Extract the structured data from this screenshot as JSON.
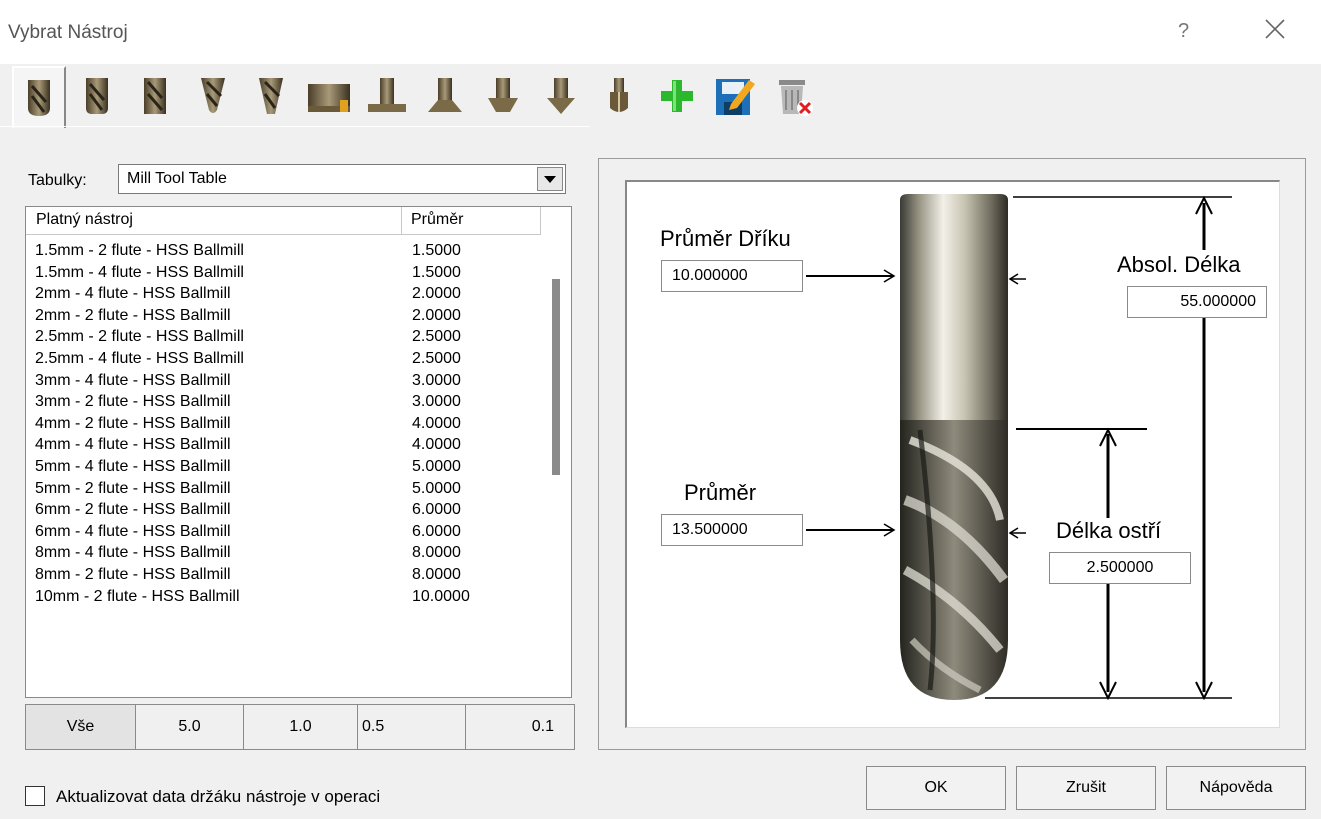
{
  "window": {
    "title": "Vybrat Nástroj",
    "help_glyph": "?",
    "close_icon": "close-icon"
  },
  "toolbar": {
    "tools": [
      {
        "name": "ballmill-tool-icon",
        "selected": true
      },
      {
        "name": "bullnose-tool-icon"
      },
      {
        "name": "flat-endmill-tool-icon"
      },
      {
        "name": "taper-ballmill-tool-icon"
      },
      {
        "name": "taper-endmill-tool-icon"
      },
      {
        "name": "face-mill-tool-icon"
      },
      {
        "name": "t-slot-tool-icon"
      },
      {
        "name": "dovetail-tool-icon"
      },
      {
        "name": "lollipop-tool-icon"
      },
      {
        "name": "drill-tool-icon"
      },
      {
        "name": "reamer-tool-icon"
      },
      {
        "name": "add-tool-icon"
      },
      {
        "name": "edit-tool-icon"
      },
      {
        "name": "delete-tool-icon"
      }
    ]
  },
  "table_selector": {
    "label": "Tabulky:",
    "value": "Mill Tool Table"
  },
  "tool_list": {
    "headers": {
      "name": "Platný nástroj",
      "diameter": "Průměr"
    },
    "rows": [
      {
        "name": "1.5mm - 2 flute - HSS Ballmill",
        "diameter": "1.5000"
      },
      {
        "name": "1.5mm - 4 flute - HSS Ballmill",
        "diameter": "1.5000"
      },
      {
        "name": "2mm - 4 flute - HSS Ballmill",
        "diameter": "2.0000"
      },
      {
        "name": "2mm - 2 flute - HSS Ballmill",
        "diameter": "2.0000"
      },
      {
        "name": "2.5mm - 2 flute - HSS Ballmill",
        "diameter": "2.5000"
      },
      {
        "name": "2.5mm - 4 flute - HSS Ballmill",
        "diameter": "2.5000"
      },
      {
        "name": "3mm - 4 flute - HSS Ballmill",
        "diameter": "3.0000"
      },
      {
        "name": "3mm - 2 flute - HSS Ballmill",
        "diameter": "3.0000"
      },
      {
        "name": "4mm - 2 flute - HSS Ballmill",
        "diameter": "4.0000"
      },
      {
        "name": "4mm - 4 flute - HSS Ballmill",
        "diameter": "4.0000"
      },
      {
        "name": "5mm - 4 flute - HSS Ballmill",
        "diameter": "5.0000"
      },
      {
        "name": "5mm - 2 flute - HSS Ballmill",
        "diameter": "5.0000"
      },
      {
        "name": "6mm - 2 flute - HSS Ballmill",
        "diameter": "6.0000"
      },
      {
        "name": "6mm - 4 flute - HSS Ballmill",
        "diameter": "6.0000"
      },
      {
        "name": "8mm - 4 flute - HSS Ballmill",
        "diameter": "8.0000"
      },
      {
        "name": "8mm - 2 flute - HSS Ballmill",
        "diameter": "8.0000"
      },
      {
        "name": "10mm - 2 flute - HSS Ballmill",
        "diameter": "10.0000"
      }
    ]
  },
  "filters": {
    "buttons": [
      "Vše",
      "5.0",
      "1.0",
      "0.5",
      "0.1"
    ],
    "selected": "Vše"
  },
  "update_holder": {
    "label": "Aktualizovat data držáku nástroje v operaci",
    "checked": false
  },
  "diagram": {
    "shank_diameter_label": "Průměr Dříku",
    "shank_diameter_value": "10.000000",
    "overall_length_label": "Absol. Délka",
    "overall_length_value": "55.000000",
    "diameter_label": "Průměr",
    "diameter_value": "13.500000",
    "flute_length_label": "Délka ostří",
    "flute_length_value": "2.500000"
  },
  "buttons": {
    "ok": "OK",
    "cancel": "Zrušit",
    "help": "Nápověda"
  }
}
